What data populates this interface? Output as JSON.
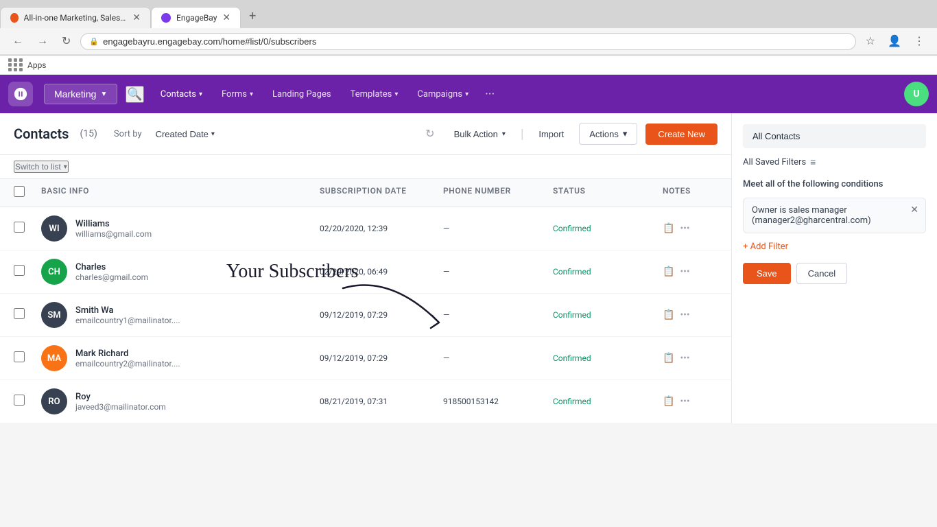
{
  "browser": {
    "tabs": [
      {
        "id": "tab1",
        "label": "All-in-one Marketing, Sales, Supp...",
        "icon_color": "orange",
        "active": false
      },
      {
        "id": "tab2",
        "label": "EngageBay",
        "icon_color": "purple",
        "active": true
      }
    ],
    "url": "engagebayru.engagebay.com/home#list/0/subscribers",
    "new_tab_label": "+"
  },
  "apps_bar": {
    "label": "Apps"
  },
  "nav": {
    "marketing_label": "Marketing",
    "search_placeholder": "Search",
    "links": [
      {
        "id": "contacts",
        "label": "Contacts",
        "has_chevron": true
      },
      {
        "id": "forms",
        "label": "Forms",
        "has_chevron": true
      },
      {
        "id": "landing_pages",
        "label": "Landing Pages",
        "has_chevron": false
      },
      {
        "id": "templates",
        "label": "Templates",
        "has_chevron": true
      },
      {
        "id": "campaigns",
        "label": "Campaigns",
        "has_chevron": true
      }
    ],
    "more_dots": "···"
  },
  "contacts_page": {
    "title": "Contacts",
    "count": "(15)",
    "sort_by_label": "Sort by",
    "sort_value": "Created Date",
    "refresh_icon": "↻",
    "bulk_action_label": "Bulk Action",
    "import_label": "Import",
    "actions_label": "Actions",
    "create_new_label": "Create New",
    "switch_to_list_label": "Switch to list"
  },
  "table": {
    "headers": [
      "",
      "Basic Info",
      "Subscription Date",
      "Phone Number",
      "Status",
      "Notes"
    ],
    "rows": [
      {
        "initials": "WI",
        "avatar_color": "#374151",
        "name": "Williams",
        "email": "williams@gmail.com",
        "subscription_date": "02/20/2020, 12:39",
        "phone": "—",
        "status": "Confirmed"
      },
      {
        "initials": "CH",
        "avatar_color": "#16a34a",
        "name": "Charles",
        "email": "charles@gmail.com",
        "subscription_date": "02/20/2020, 06:49",
        "phone": "—",
        "status": "Confirmed"
      },
      {
        "initials": "SM",
        "avatar_color": "#374151",
        "name": "Smith Wa",
        "email": "emailcountry1@mailinator....",
        "subscription_date": "09/12/2019, 07:29",
        "phone": "—",
        "status": "Confirmed"
      },
      {
        "initials": "MA",
        "avatar_color": "#f97316",
        "name": "Mark Richard",
        "email": "emailcountry2@mailinator....",
        "subscription_date": "09/12/2019, 07:29",
        "phone": "—",
        "status": "Confirmed"
      },
      {
        "initials": "RO",
        "avatar_color": "#374151",
        "name": "Roy",
        "email": "javeed3@mailinator.com",
        "subscription_date": "08/21/2019, 07:31",
        "phone": "918500153142",
        "status": "Confirmed"
      }
    ]
  },
  "right_panel": {
    "all_contacts_label": "All Contacts",
    "all_saved_filters_label": "All Saved Filters",
    "meet_conditions_label": "Meet all of the following conditions",
    "filter_text": "Owner is sales manager (manager2@gharcentral.com)",
    "add_filter_label": "+ Add Filter",
    "save_label": "Save",
    "cancel_label": "Cancel"
  },
  "overlay": {
    "subscribers_text": "Your Subscribers"
  }
}
